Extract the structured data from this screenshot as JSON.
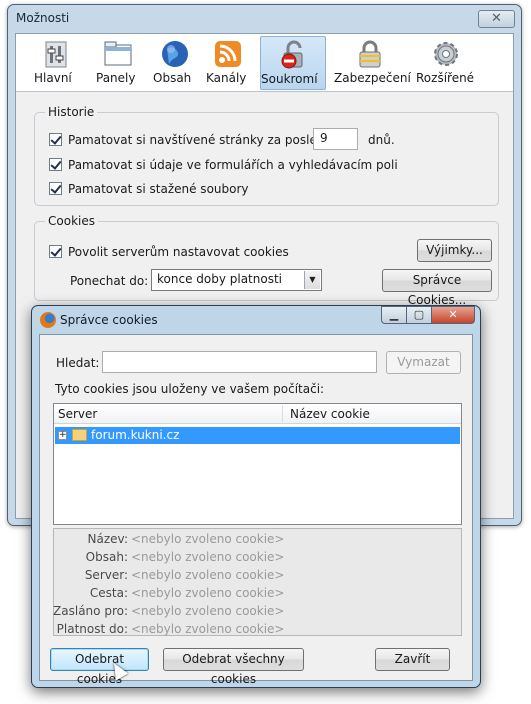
{
  "main_window": {
    "title": "Možnosti",
    "close_glyph": "✕",
    "toolbar": [
      {
        "label": "Hlavní",
        "icon": "switches-icon"
      },
      {
        "label": "Panely",
        "icon": "tabs-icon"
      },
      {
        "label": "Obsah",
        "icon": "globe-icon"
      },
      {
        "label": "Kanály",
        "icon": "rss-icon"
      },
      {
        "label": "Soukromí",
        "icon": "lock-icon",
        "active": true
      },
      {
        "label": "Zabezpečení",
        "icon": "padlock-icon"
      },
      {
        "label": "Rozšířené",
        "icon": "gear-icon"
      }
    ],
    "history": {
      "title": "Historie",
      "remember_visited_label": "Pamatovat si navštívené stránky za posledních",
      "days_value": "9",
      "days_unit": "dnů.",
      "remember_forms_label": "Pamatovat si údaje ve formulářích a vyhledávacím poli",
      "remember_downloads_label": "Pamatovat si stažené soubory"
    },
    "cookies": {
      "title": "Cookies",
      "allow_label": "Povolit serverům nastavovat cookies",
      "exceptions_button": "Výjimky...",
      "keep_until_label": "Ponechat do:",
      "keep_until_value": "konce doby platnosti",
      "manager_button": "Správce Cookies..."
    }
  },
  "cookie_manager": {
    "title": "Správce cookies",
    "min_glyph": "▁",
    "max_glyph": "▢",
    "close_glyph": "✕",
    "search_label": "Hledat:",
    "search_value": "",
    "clear_button": "Vymazat",
    "info_text": "Tyto cookies jsou uloženy ve vašem počítači:",
    "columns": [
      "Server",
      "Název cookie"
    ],
    "rows": [
      {
        "server": "forum.kukni.cz",
        "name": ""
      }
    ],
    "expander_glyph": "+",
    "details": [
      {
        "key": "Název:",
        "value": "<nebylo zvoleno cookie>"
      },
      {
        "key": "Obsah:",
        "value": "<nebylo zvoleno cookie>"
      },
      {
        "key": "Server:",
        "value": "<nebylo zvoleno cookie>"
      },
      {
        "key": "Cesta:",
        "value": "<nebylo zvoleno cookie>"
      },
      {
        "key": "Zasláno pro:",
        "value": "<nebylo zvoleno cookie>"
      },
      {
        "key": "Platnost do:",
        "value": "<nebylo zvoleno cookie>"
      }
    ],
    "remove_button": "Odebrat cookies",
    "remove_all_button": "Odebrat všechny cookies",
    "close_button": "Zavřít"
  },
  "colors": {
    "selection": "#3399ff",
    "window_frame": "#c7d9e8"
  }
}
